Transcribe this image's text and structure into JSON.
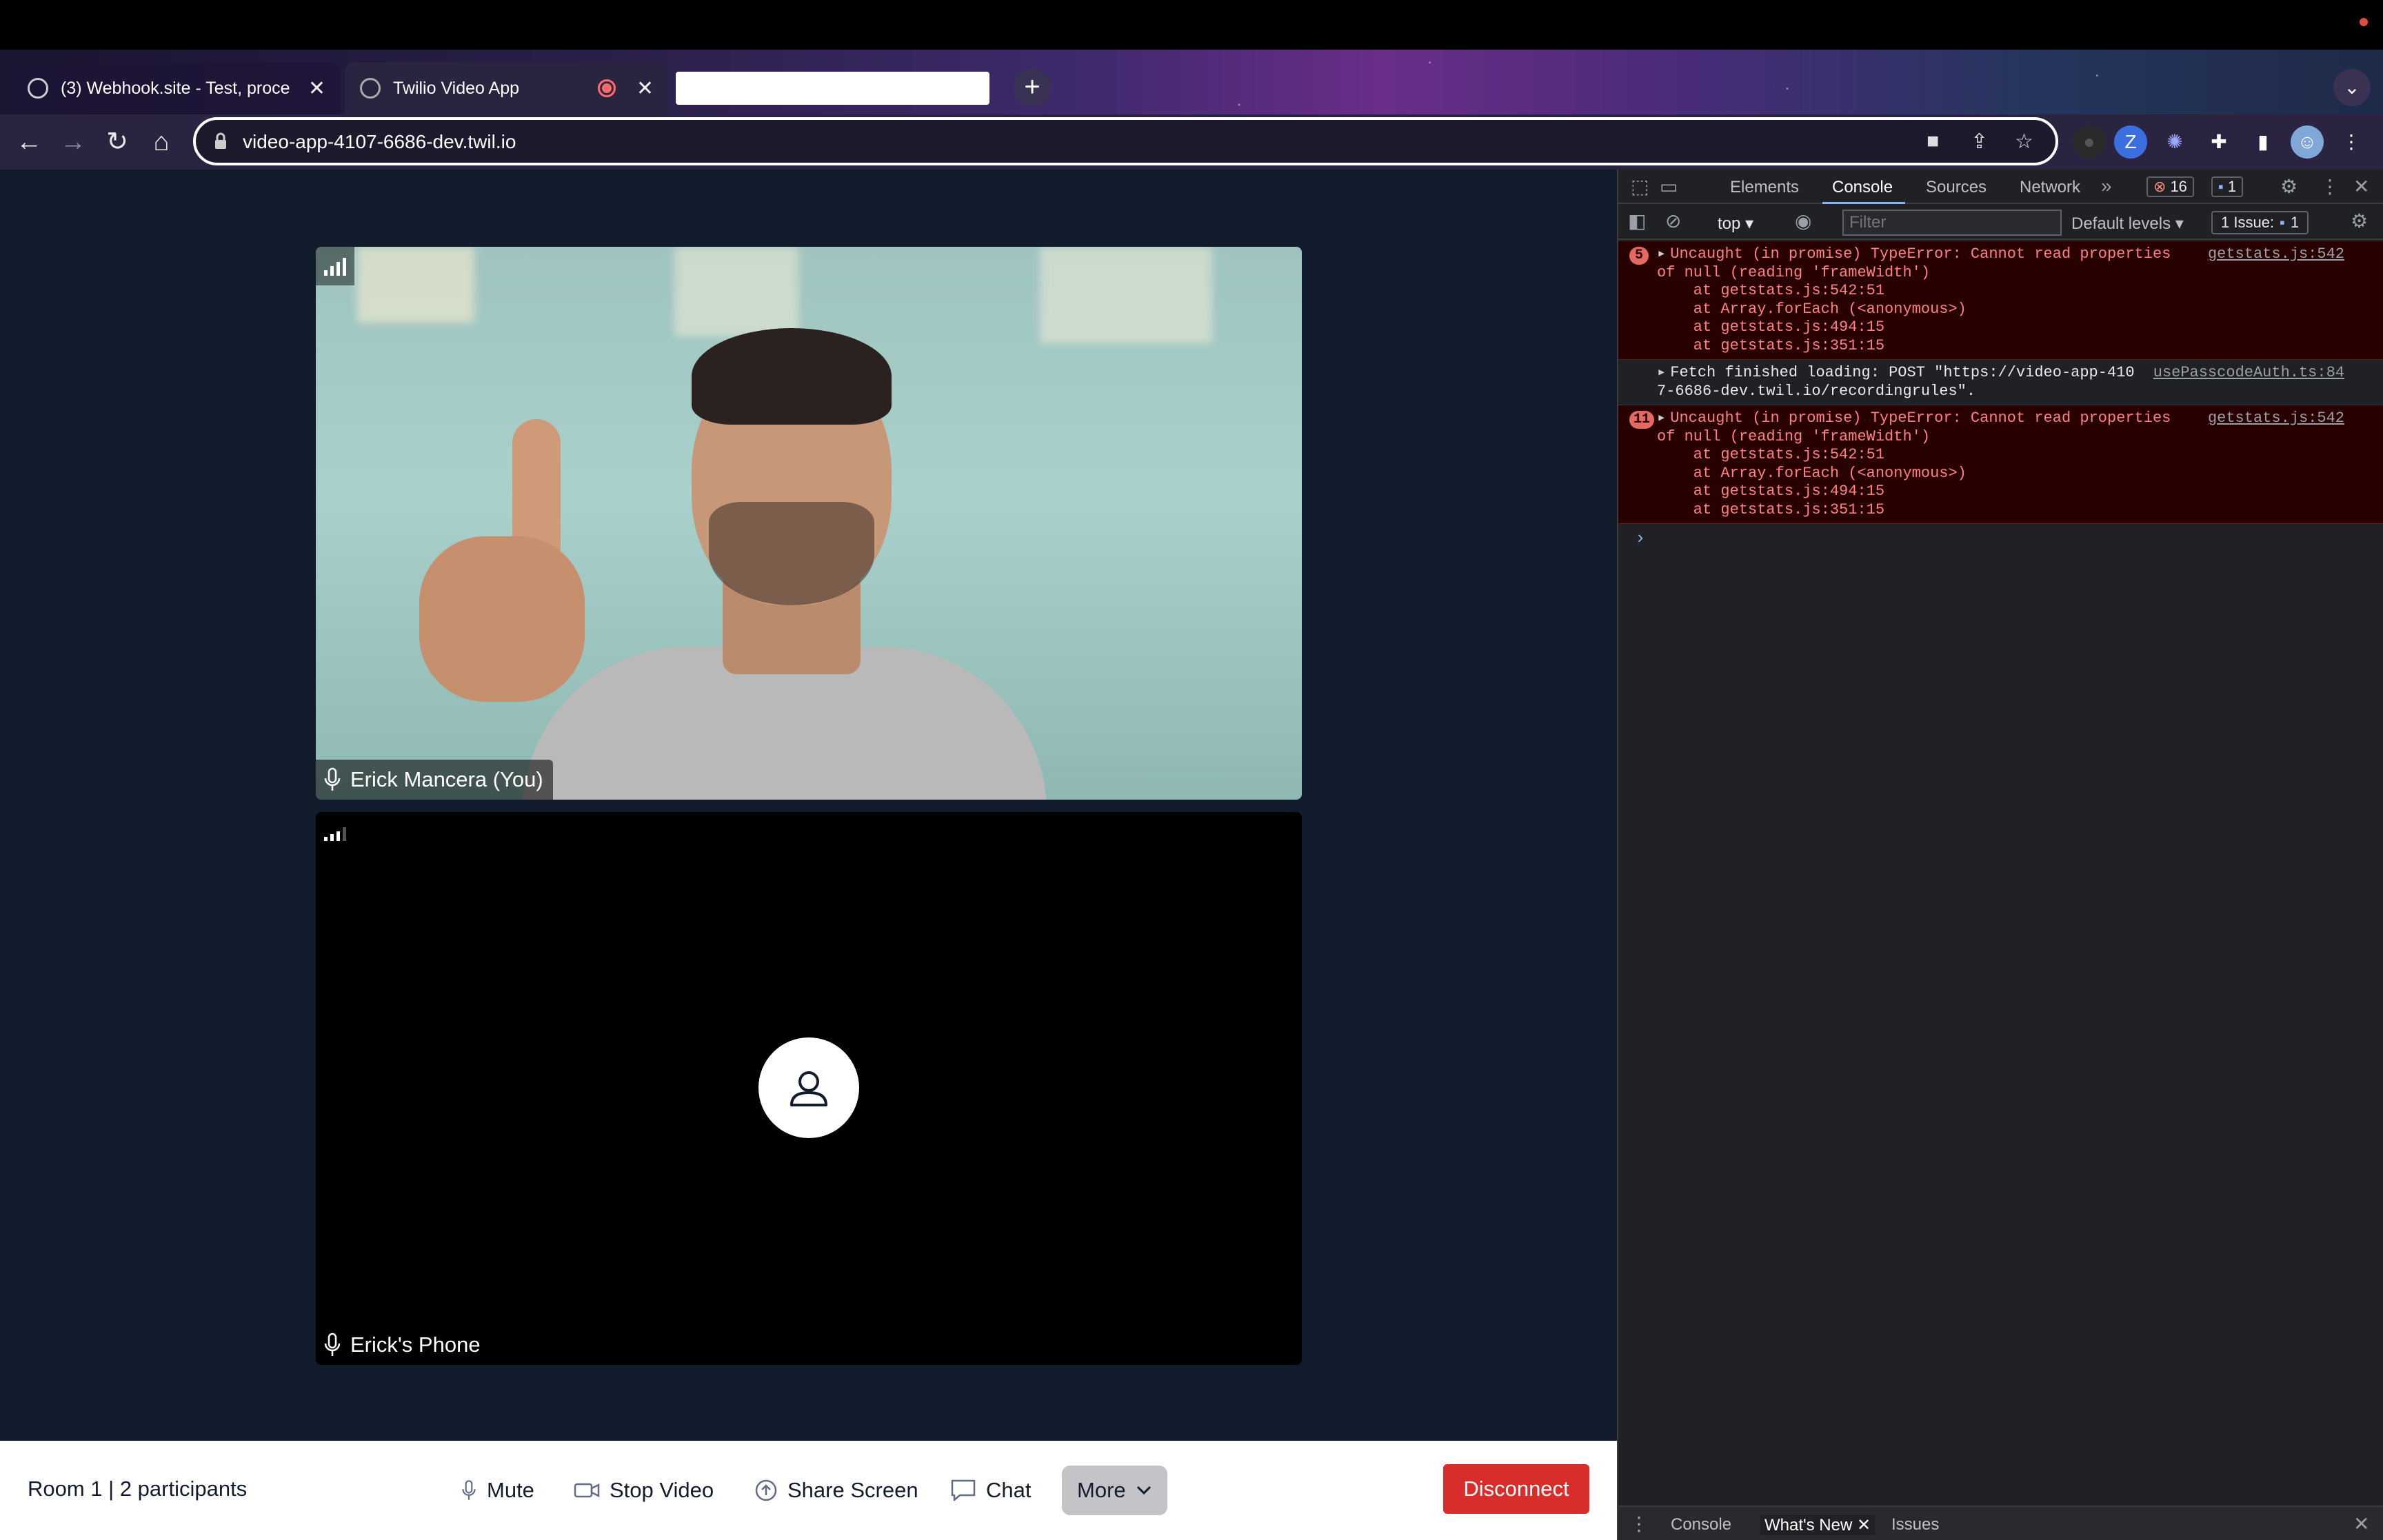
{
  "browser": {
    "tabs": [
      {
        "title": "(3) Webhook.site - Test, proce",
        "active": false
      },
      {
        "title": "Twilio Video App",
        "active": true
      }
    ],
    "url": "video-app-4107-6686-dev.twil.io"
  },
  "room": {
    "info": "Room 1 | 2 participants",
    "participants": [
      {
        "name": "Erick Mancera (You)",
        "video": true
      },
      {
        "name": "Erick's Phone",
        "video": false
      }
    ]
  },
  "controls": {
    "mute": "Mute",
    "stop_video": "Stop Video",
    "share_screen": "Share Screen",
    "chat": "Chat",
    "more": "More",
    "disconnect": "Disconnect"
  },
  "devtools": {
    "tabs": [
      "Elements",
      "Console",
      "Sources",
      "Network"
    ],
    "active_tab": "Console",
    "error_count": "16",
    "message_count": "1",
    "context": "top",
    "filter_placeholder": "Filter",
    "levels": "Default levels",
    "issues_label": "1 Issue:",
    "issues_count": "1",
    "messages": [
      {
        "type": "error",
        "count": "5",
        "source": "getstats.js:542",
        "lines": [
          "Uncaught (in promise) TypeError: Cannot read properties",
          "of null (reading 'frameWidth')",
          "    at getstats.js:542:51",
          "    at Array.forEach (<anonymous>)",
          "    at getstats.js:494:15",
          "    at getstats.js:351:15"
        ]
      },
      {
        "type": "info",
        "source": "usePasscodeAuth.ts:84",
        "lines": [
          "Fetch finished loading: POST \"https://video-app-410",
          "7-6686-dev.twil.io/recordingrules\"."
        ]
      },
      {
        "type": "error",
        "count": "11",
        "source": "getstats.js:542",
        "lines": [
          "Uncaught (in promise) TypeError: Cannot read properties",
          "of null (reading 'frameWidth')",
          "    at getstats.js:542:51",
          "    at Array.forEach (<anonymous>)",
          "    at getstats.js:494:15",
          "    at getstats.js:351:15"
        ]
      }
    ],
    "drawer_tabs": [
      "Console",
      "What's New",
      "Issues"
    ]
  },
  "colors": {
    "app_bg": "#121c2d",
    "disconnect": "#d72e2b",
    "error_bg": "#290000",
    "error_text": "#ff8080"
  }
}
